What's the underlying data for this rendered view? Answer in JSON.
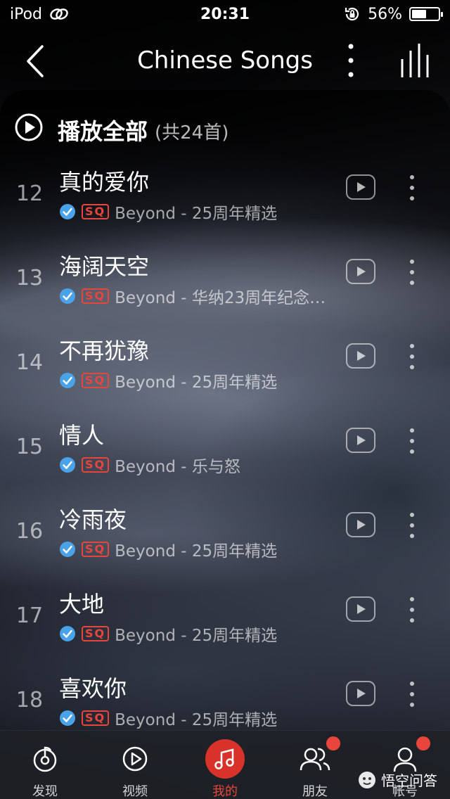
{
  "status_bar": {
    "device": "iPod",
    "time": "20:31",
    "battery_percent": "56%",
    "battery_level": 0.56
  },
  "nav": {
    "title": "Chinese Songs"
  },
  "play_all": {
    "label": "播放全部",
    "count": "(共24首)"
  },
  "songs": [
    {
      "index": "12",
      "title": "真的爱你",
      "artist": "Beyond",
      "album": "25周年精选",
      "meta": "Beyond - 25周年精选"
    },
    {
      "index": "13",
      "title": "海阔天空",
      "artist": "Beyond",
      "album": "华纳23周年纪念…",
      "meta": "Beyond - 华纳23周年纪念…"
    },
    {
      "index": "14",
      "title": "不再犹豫",
      "artist": "Beyond",
      "album": "25周年精选",
      "meta": "Beyond - 25周年精选"
    },
    {
      "index": "15",
      "title": "情人",
      "artist": "Beyond",
      "album": "乐与怒",
      "meta": "Beyond - 乐与怒"
    },
    {
      "index": "16",
      "title": "冷雨夜",
      "artist": "Beyond",
      "album": "25周年精选",
      "meta": "Beyond - 25周年精选"
    },
    {
      "index": "17",
      "title": "大地",
      "artist": "Beyond",
      "album": "25周年精选",
      "meta": "Beyond - 25周年精选"
    },
    {
      "index": "18",
      "title": "喜欢你",
      "artist": "Beyond",
      "album": "25周年精选",
      "meta": "Beyond - 25周年精选"
    }
  ],
  "quality_badge": "SQ",
  "tabs": [
    {
      "label": "发现",
      "icon": "discover-icon"
    },
    {
      "label": "视频",
      "icon": "video-icon"
    },
    {
      "label": "我的",
      "icon": "music-note-icon",
      "active": true
    },
    {
      "label": "朋友",
      "icon": "friends-icon",
      "badge": true
    },
    {
      "label": "帐号",
      "icon": "account-icon",
      "badge": true
    }
  ],
  "watermark": "悟空问答",
  "colors": {
    "accent": "#e8453c",
    "verified": "#4aa3e8"
  }
}
